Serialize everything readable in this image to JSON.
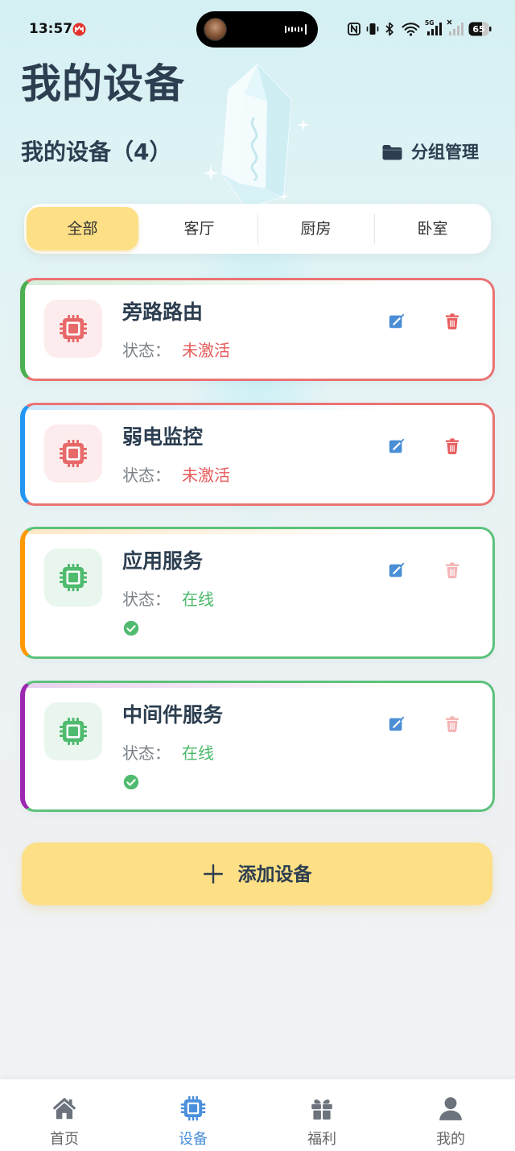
{
  "status_bar": {
    "time": "13:57",
    "network": "5G",
    "battery": "65"
  },
  "header": {
    "title": "我的设备"
  },
  "subheader": {
    "title": "我的设备（4）",
    "group_manage_label": "分组管理",
    "group_manage_icon": "folder-icon"
  },
  "tabs": [
    {
      "label": "全部",
      "active": true
    },
    {
      "label": "客厅",
      "active": false
    },
    {
      "label": "厨房",
      "active": false
    },
    {
      "label": "卧室",
      "active": false
    }
  ],
  "devices": [
    {
      "name": "旁路路由",
      "status_label": "状态：",
      "status_text": "未激活",
      "accent": "#4caf50"
    },
    {
      "name": "弱电监控",
      "status_label": "状态：",
      "status_text": "未激活",
      "accent": "#2196f3"
    },
    {
      "name": "应用服务",
      "status_label": "状态：",
      "status_text": "在线",
      "accent": "#ff9800"
    },
    {
      "name": "中间件服务",
      "status_label": "状态：",
      "status_text": "在线",
      "accent": "#9c27b0"
    }
  ],
  "add_button": {
    "icon": "plus-icon",
    "label": "添加设备"
  },
  "bottom_nav": {
    "items": [
      {
        "label": "首页",
        "icon": "home-icon",
        "active": false
      },
      {
        "label": "设备",
        "icon": "chip-icon",
        "active": true
      },
      {
        "label": "福利",
        "icon": "gift-icon",
        "active": false
      },
      {
        "label": "我的",
        "icon": "user-icon",
        "active": false
      }
    ]
  },
  "colors": {
    "accent_yellow": "#fddf86",
    "text_primary": "#2c3e50",
    "inactive_red": "#e8696a",
    "online_green": "#4fbb6e",
    "edit_blue": "#4a8ed6",
    "nav_active_blue": "#4a8fdc",
    "nav_inactive_gray": "#6c737d"
  }
}
